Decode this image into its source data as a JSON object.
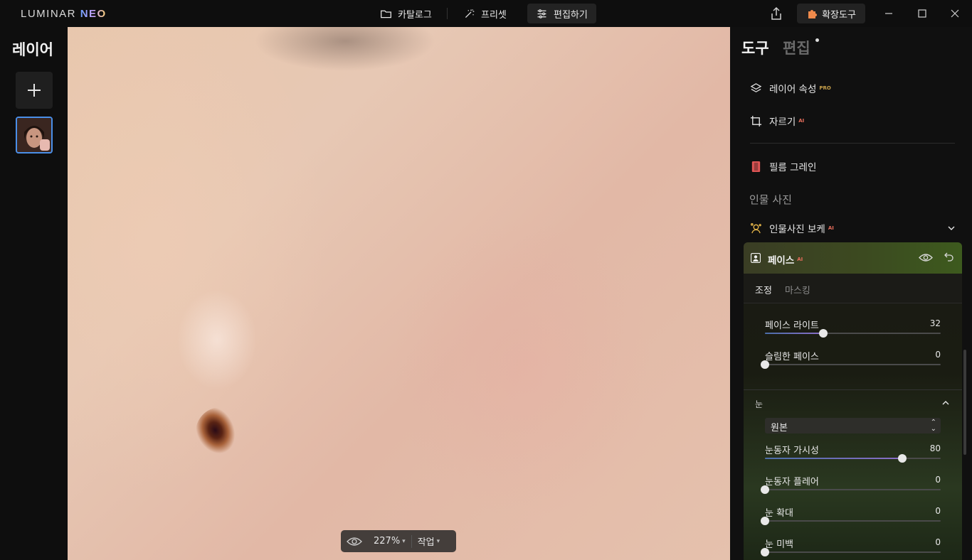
{
  "app": {
    "logo_main": "LUMINAR",
    "logo_neo": "NEO"
  },
  "nav": {
    "catalog": "카탈로그",
    "presets": "프리셋",
    "edit": "편집하기",
    "extensions": "확장도구"
  },
  "left_panel": {
    "title": "레이어"
  },
  "canvas": {
    "zoom": "227%",
    "work": "작업"
  },
  "right_panel": {
    "tab_tools": "도구",
    "tab_edit": "편집",
    "tools": [
      {
        "label": "레이어 속성",
        "badge": "PRO"
      },
      {
        "label": "자르기",
        "badge": "AI"
      },
      {
        "label": "필름 그레인",
        "badge": ""
      }
    ],
    "portrait_section": "인물 사진",
    "portrait_bokeh": {
      "label": "인물사진 보케",
      "badge": "AI"
    },
    "face": {
      "title": "페이스",
      "badge": "AI",
      "subtabs": [
        "조정",
        "마스킹"
      ],
      "sliders": [
        {
          "label": "페이스 라이트",
          "value": 32,
          "fraction": 0.33
        },
        {
          "label": "슬림한 페이스",
          "value": 0,
          "fraction": 0
        }
      ],
      "eye_section": "눈",
      "eye_select": "원본",
      "eye_sliders": [
        {
          "label": "눈동자 가시성",
          "value": 80,
          "fraction": 0.78
        },
        {
          "label": "눈동자 플레어",
          "value": 0,
          "fraction": 0
        },
        {
          "label": "눈 확대",
          "value": 0,
          "fraction": 0
        },
        {
          "label": "눈 미백",
          "value": 0,
          "fraction": 0
        }
      ]
    }
  },
  "colors": {
    "accent_blue": "#4a8fe8",
    "pro_badge": "#c7a04b",
    "ai_badge": "#e66d5b",
    "film_icon": "#e05555",
    "portrait_icon": "#e9b84a",
    "extension_icon": "#f08a4b"
  },
  "icons": [
    "folder-icon",
    "magic-wand-icon",
    "sliders-icon",
    "share-icon",
    "puzzle-icon",
    "minimize-icon",
    "maximize-icon",
    "close-icon",
    "plus-icon",
    "layers-icon",
    "crop-icon",
    "film-icon",
    "portrait-icon",
    "chevron-down-icon",
    "face-icon",
    "eye-icon",
    "undo-icon",
    "chevron-up-icon"
  ]
}
